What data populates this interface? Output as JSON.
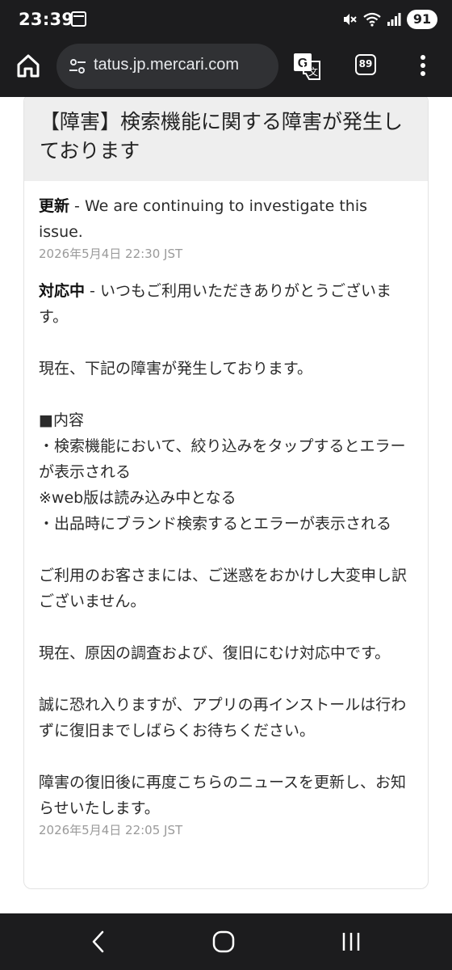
{
  "status_bar": {
    "time": "23:39",
    "battery": "91",
    "icons": [
      "calendar-icon",
      "mute-icon",
      "wifi-icon",
      "signal-icon",
      "battery-icon"
    ]
  },
  "browser": {
    "url": "status.jp.mercari.com",
    "url_visible": "tatus.jp.mercari.com",
    "tab_count": "89",
    "icons": [
      "home-icon",
      "site-settings-icon",
      "translate-icon",
      "tabs-icon",
      "more-vert-icon"
    ]
  },
  "incident": {
    "title": "【障害】検索機能に関する障害が発生しております",
    "updates": [
      {
        "status": "更新",
        "separator": " - ",
        "paragraphs": [
          "We are continuing to investigate this issue."
        ],
        "time": "2026年5月4日 22:30 JST"
      },
      {
        "status": "対応中",
        "separator": " - ",
        "paragraphs": [
          "いつもご利用いただきありがとうございます。",
          "",
          "現在、下記の障害が発生しております。",
          "",
          "■内容",
          "・検索機能において、絞り込みをタップするとエラーが表示される",
          "※web版は読み込み中となる",
          "・出品時にブランド検索するとエラーが表示される",
          "",
          "ご利用のお客さまには、ご迷惑をおかけし大変申し訳ございません。",
          "",
          "現在、原因の調査および、復旧にむけ対応中です。",
          "",
          "誠に恐れ入りますが、アプリの再インストールは行わずに復旧までしばらくお待ちください。",
          "",
          "障害の復旧後に再度こちらのニュースを更新し、お知らせいたします。"
        ],
        "time": "2026年5月4日 22:05 JST"
      }
    ]
  },
  "nav_bar": {
    "icons": [
      "back-icon",
      "home-circle-icon",
      "recent-apps-icon"
    ]
  },
  "colors": {
    "system_bar": "#1c1c1e",
    "url_bar": "#303134",
    "card_header": "#eeeeee",
    "card_border": "#e3e3e3",
    "timestamp": "#9a9a9a"
  }
}
